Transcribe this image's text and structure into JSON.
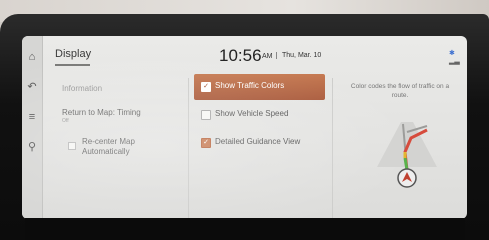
{
  "header": {
    "title": "Display",
    "time": "10:56",
    "ampm": "AM",
    "date": "Thu, Mar. 10"
  },
  "rail": {
    "home_icon": "home-icon",
    "back_icon": "back-icon",
    "menu_icon": "menu-icon",
    "search_icon": "search-icon"
  },
  "menu": {
    "information": "Information",
    "return_label": "Return to Map: Timing",
    "return_value": "Off",
    "recenter_label_1": "Re-center Map",
    "recenter_label_2": "Automatically"
  },
  "options": [
    {
      "label": "Show Traffic Colors",
      "checked": true
    },
    {
      "label": "Show Vehicle Speed",
      "checked": false
    },
    {
      "label": "Detailed Guidance View",
      "checked": true
    }
  ],
  "description": {
    "line1": "Color codes the flow of traffic on a",
    "line2": "route."
  },
  "colors": {
    "selected": "#b4623f",
    "accent": "#c67a52"
  }
}
